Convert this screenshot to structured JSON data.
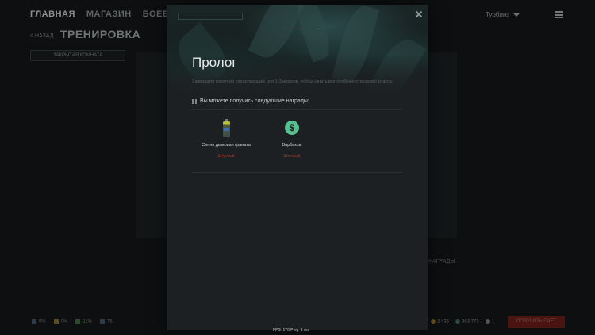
{
  "nav": {
    "items": [
      "ГЛАВНАЯ",
      "МАГАЗИН",
      "БОЕВОЙ ПРОПУ"
    ]
  },
  "user": {
    "name": "Турбинэ"
  },
  "page": {
    "back_label": "< НАЗАД",
    "title": "ТРЕНИРОВКА",
    "closed_room": "ЗАКРЫТАЯ КОМНАТА",
    "side_label": "НАГРАДЫ"
  },
  "bottom": {
    "stats": [
      "0%",
      "0%",
      "11%",
      "75"
    ],
    "currencies": [
      "2 436",
      "363 773",
      "1"
    ],
    "cta": "ПОЛУЧИТЬ СЧЁТ",
    "fps": "FPS: 178   Ping: 1  ms"
  },
  "modal": {
    "title": "Пролог",
    "description": "Завершите короткую спецоперацию для 1-3 игроков, чтобы узнать все особенности своего класса.",
    "rewards_heading": "Вы можете получить следующие награды:",
    "rewards": [
      {
        "name": "Синяя дымовая граната",
        "tag": "Штучный",
        "icon": "smoke-grenade-icon"
      },
      {
        "name": "Варбаксы",
        "tag": "Штучный",
        "icon": "warbucks-icon"
      }
    ],
    "warbucks_symbol": "$"
  },
  "colors": {
    "modal_bg": "#1d2022",
    "accent_green": "#55c08e",
    "tag_red": "#b23a2c"
  }
}
